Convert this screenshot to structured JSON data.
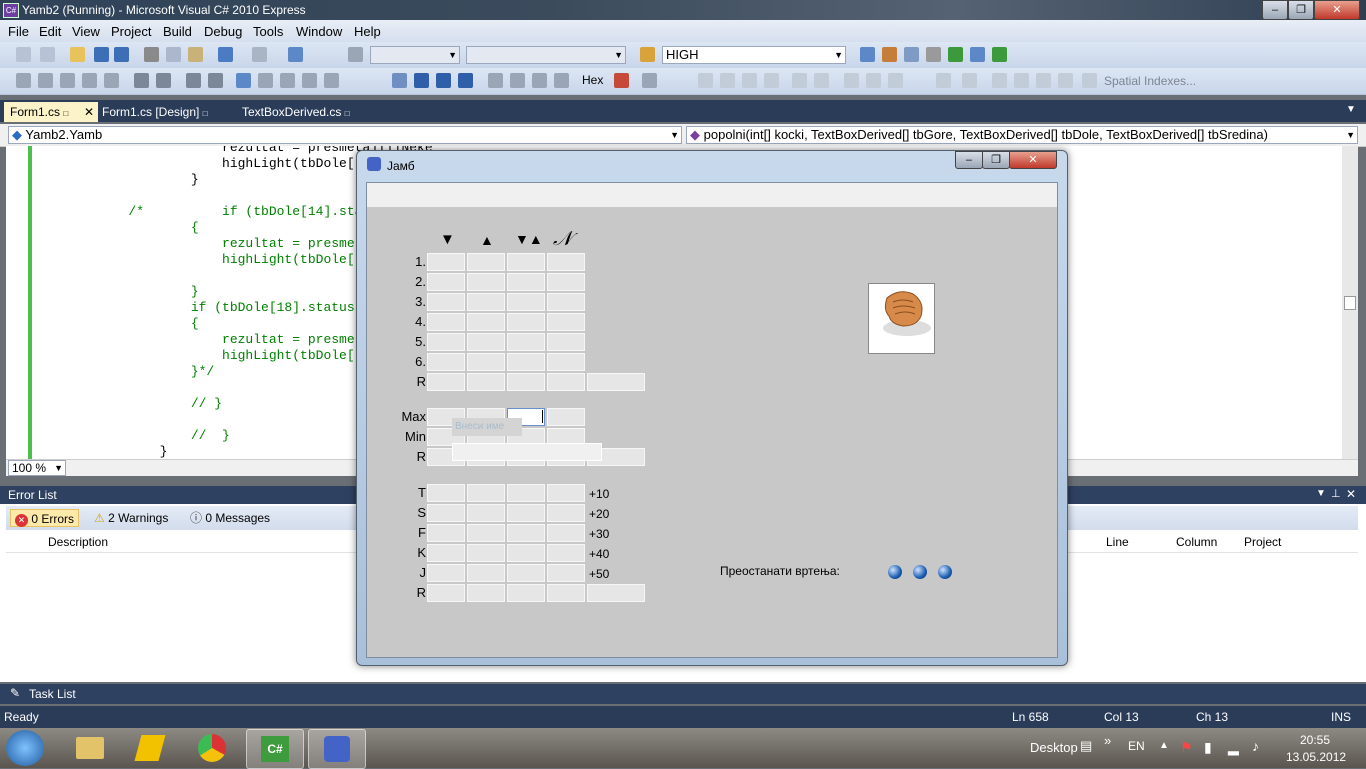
{
  "window": {
    "title": "Yamb2 (Running) - Microsoft Visual C# 2010 Express",
    "minimize": "–",
    "restore": "❐",
    "close": "✕"
  },
  "menu": [
    "File",
    "Edit",
    "View",
    "Project",
    "Build",
    "Debug",
    "Tools",
    "Window",
    "Help"
  ],
  "toolbar": {
    "config_combo": "HIGH",
    "hex_label": "Hex",
    "spatial_label": "Spatial Indexes..."
  },
  "tabs": [
    {
      "label": "Form1.cs",
      "lock": "🔒",
      "active": true
    },
    {
      "label": "Form1.cs [Design]",
      "lock": "🔒"
    },
    {
      "label": "TextBoxDerived.cs",
      "lock": "🔒"
    }
  ],
  "tab_close": "✕",
  "navbar": {
    "left": "Yamb2.Yamb",
    "right": "popolni(int[] kocki, TextBoxDerived[] tbGore, TextBoxDerived[] tbDole, TextBoxDerived[] tbSredina)"
  },
  "code_lines": [
    "                    rezultat = presmetajIliNeke",
    "                    highLight(tbDole[",
    "                }",
    "",
    "        /*          if (tbDole[14].sta",
    "                {",
    "                    rezultat = presme",
    "                    highLight(tbDole[",
    "",
    "                }",
    "                if (tbDole[18].status",
    "                {",
    "                    rezultat = presme",
    "                    highLight(tbDole[",
    "                }*/",
    "",
    "                // }",
    "",
    "                //  }",
    "            }"
  ],
  "zoom": "100 %",
  "error_list": {
    "title": "Error List",
    "errors": "0 Errors",
    "warnings": "2 Warnings",
    "messages": "0 Messages",
    "columns": [
      "Description",
      "Line",
      "Column",
      "Project"
    ]
  },
  "task_list": "Task List",
  "status": {
    "ready": "Ready",
    "ln": "Ln 658",
    "col": "Col 13",
    "ch": "Ch 13",
    "ins": "INS"
  },
  "taskbar": {
    "desktop": "Desktop",
    "lang": "EN",
    "time": "20:55",
    "date": "13.05.2012"
  },
  "app": {
    "title": "Јамб",
    "column_headers": [
      "▼",
      "▲",
      "▼▲",
      "𝒩"
    ],
    "upper_rows": [
      "1.",
      "2.",
      "3.",
      "4.",
      "5.",
      "6.",
      "R"
    ],
    "middle_rows": [
      "Max",
      "Min",
      "R"
    ],
    "lower_rows": [
      "T",
      "S",
      "F",
      "K",
      "J",
      "R"
    ],
    "bonuses": [
      "+10",
      "+20",
      "+30",
      "+40",
      "+50"
    ],
    "name_hint": "Внеси име",
    "remaining_label": "Преостанати вртења:",
    "remaining_rolls": 3,
    "colors": {
      "client": "#c8c8c8",
      "cell": "#e6e6e6",
      "roll_dot": "#1a5cb0"
    }
  }
}
